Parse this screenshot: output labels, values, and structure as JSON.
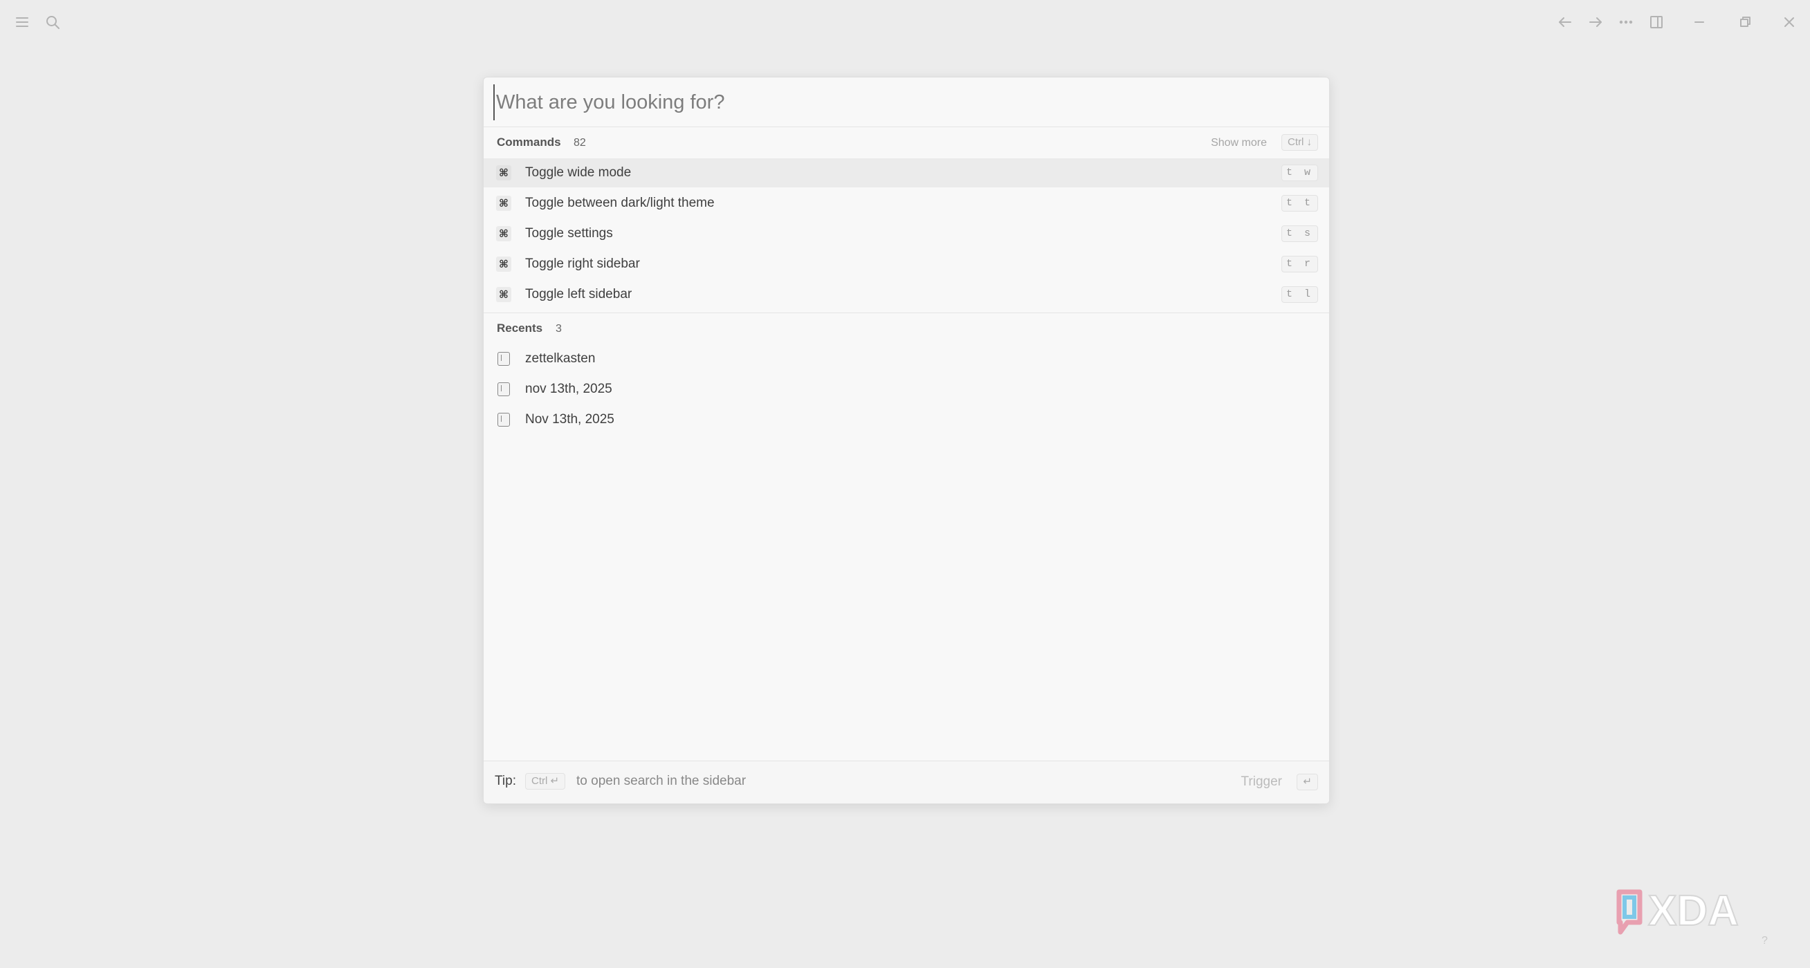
{
  "topbar": {
    "left_icons": [
      "menu-icon",
      "search-icon"
    ],
    "right_icons": [
      "arrow-left-icon",
      "arrow-right-icon",
      "more-icon",
      "sidebar-icon",
      "minimize-icon",
      "restore-icon",
      "close-icon"
    ]
  },
  "search": {
    "placeholder": "What are you looking for?",
    "value": ""
  },
  "commands": {
    "title": "Commands",
    "count": "82",
    "show_more": "Show more",
    "show_more_shortcut": "Ctrl ↓",
    "items": [
      {
        "label": "Toggle wide mode",
        "shortcut": "t w",
        "icon": "command-icon"
      },
      {
        "label": "Toggle between dark/light theme",
        "shortcut": "t t",
        "icon": "command-icon"
      },
      {
        "label": "Toggle settings",
        "shortcut": "t s",
        "icon": "command-icon"
      },
      {
        "label": "Toggle right sidebar",
        "shortcut": "t r",
        "icon": "command-icon"
      },
      {
        "label": "Toggle left sidebar",
        "shortcut": "t l",
        "icon": "command-icon"
      }
    ]
  },
  "recents": {
    "title": "Recents",
    "count": "3",
    "items": [
      {
        "label": "zettelkasten",
        "icon": "page-icon"
      },
      {
        "label": "nov 13th, 2025",
        "icon": "page-icon"
      },
      {
        "label": "Nov 13th, 2025",
        "icon": "page-icon"
      }
    ]
  },
  "footer": {
    "tip_label": "Tip:",
    "tip_shortcut": "Ctrl ↵",
    "tip_text": "to open search in the sidebar",
    "trigger_label": "Trigger",
    "trigger_key": "↵"
  },
  "watermark": {
    "brand": "XDA",
    "help": "?"
  },
  "colors": {
    "background": "#ececec",
    "palette": "#f8f8f8",
    "active_row": "#ebebeb",
    "xda_pink": "#e8a0b0",
    "xda_blue": "#7ec8e8"
  }
}
